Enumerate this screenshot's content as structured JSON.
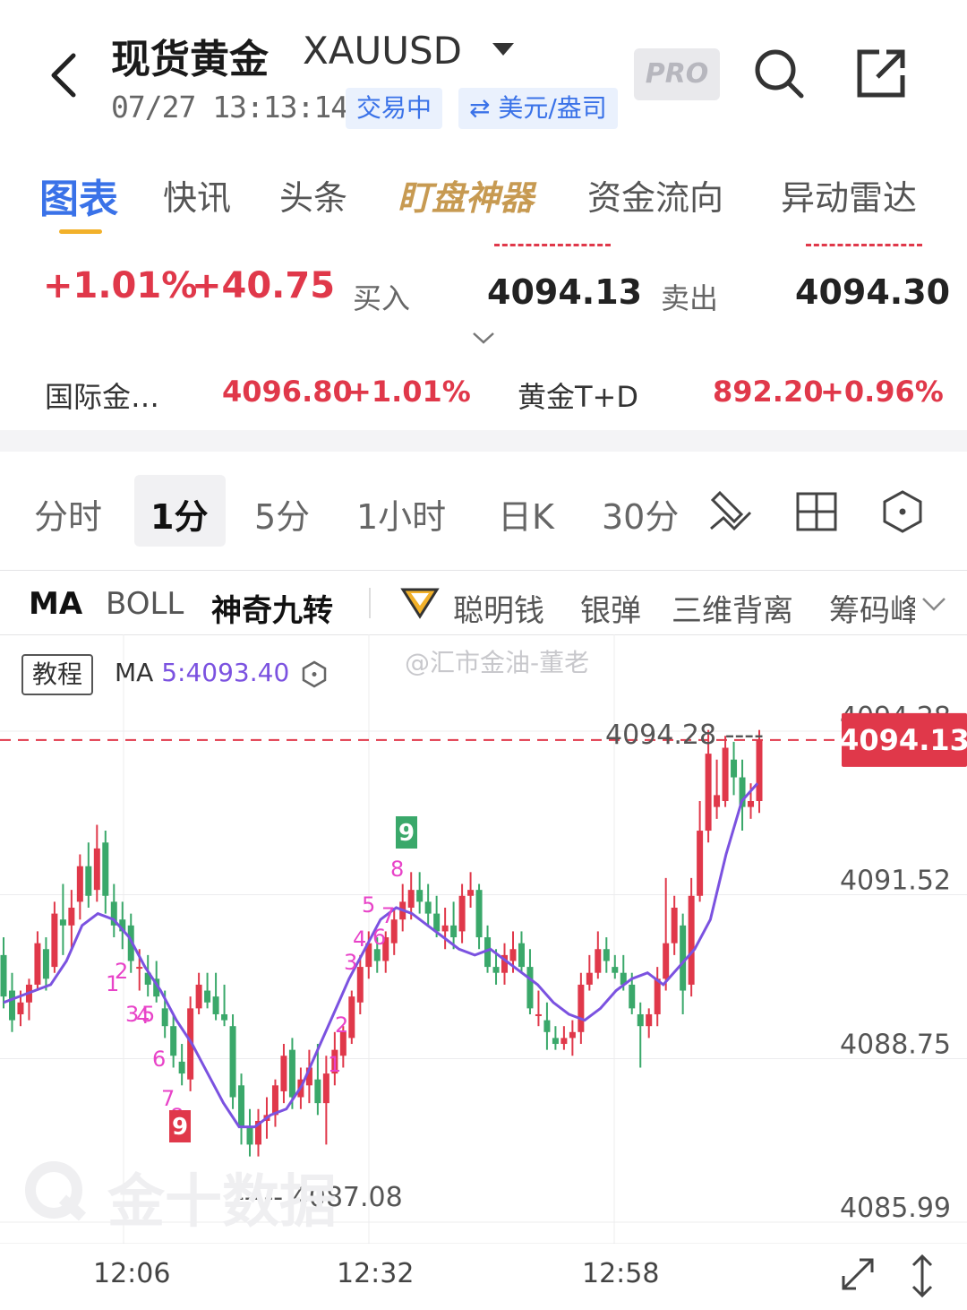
{
  "header": {
    "title": "现货黄金",
    "symbol": "XAUUSD",
    "pro_label": "PRO",
    "datetime": "07/27 13:13:14",
    "status_badge": "交易中",
    "currency_badge": "⇄ 美元/盎司"
  },
  "main_tabs": [
    "图表",
    "快讯",
    "头条",
    "盯盘神器",
    "资金流向",
    "异动雷达"
  ],
  "quote": {
    "change_pct": "+1.01%",
    "change_abs": "+40.75",
    "buy_label": "买入",
    "buy_value": "4094.13",
    "sell_label": "卖出",
    "sell_value": "4094.30"
  },
  "related": [
    {
      "name": "国际金…",
      "price": "4096.80",
      "pct": "+1.01%"
    },
    {
      "name": "黄金T+D",
      "price": "892.20",
      "pct": "+0.96%"
    }
  ],
  "period_tabs": [
    "分时",
    "1分",
    "5分",
    "1小时",
    "日K",
    "30分"
  ],
  "indicator_tabs": [
    "MA",
    "BOLL",
    "神奇九转",
    "聪明钱",
    "银弹",
    "三维背离",
    "筹码峰"
  ],
  "chart_header": {
    "tutorial_label": "教程",
    "ma_label": "MA",
    "ma_value": "5:4093.40",
    "watermark": "@汇市金油-董老",
    "logo_text": "金十数据"
  },
  "colors": {
    "up": "#e0384a",
    "down": "#3aa86a",
    "ma": "#7b52e0",
    "accent": "#3a72e8",
    "nine": "#e843c8"
  },
  "chart_data": {
    "type": "candlestick",
    "x_ticks": [
      "12:06",
      "12:32",
      "12:58"
    ],
    "y_ticks": [
      4094.28,
      4091.52,
      4088.75,
      4085.99
    ],
    "ylim": [
      4085.99,
      4094.28
    ],
    "last_price": "4094.13",
    "high_label": "4094.28",
    "low_label": "4087.08",
    "grid": true,
    "candles": [
      [
        4090.5,
        4090.8,
        4089.6,
        4089.8
      ],
      [
        4089.9,
        4090.2,
        4089.2,
        4089.4
      ],
      [
        4089.5,
        4089.9,
        4089.3,
        4089.7
      ],
      [
        4089.7,
        4090.1,
        4089.4,
        4090.0
      ],
      [
        4090.0,
        4090.9,
        4089.9,
        4090.7
      ],
      [
        4090.6,
        4090.8,
        4089.9,
        4090.1
      ],
      [
        4090.3,
        4091.4,
        4090.2,
        4091.2
      ],
      [
        4091.1,
        4091.7,
        4090.5,
        4091.0
      ],
      [
        4091.0,
        4091.6,
        4090.6,
        4091.3
      ],
      [
        4091.4,
        4092.2,
        4091.1,
        4092.0
      ],
      [
        4092.0,
        4092.4,
        4091.3,
        4091.5
      ],
      [
        4091.6,
        4092.7,
        4091.4,
        4092.3
      ],
      [
        4092.4,
        4092.6,
        4091.2,
        4091.5
      ],
      [
        4091.4,
        4091.7,
        4090.8,
        4091.0
      ],
      [
        4091.1,
        4091.4,
        4090.6,
        4090.9
      ],
      [
        4091.0,
        4091.2,
        4090.2,
        4090.4
      ],
      [
        4090.3,
        4090.6,
        4089.9,
        4090.3
      ],
      [
        4090.2,
        4090.5,
        4089.8,
        4090.0
      ],
      [
        4090.1,
        4090.4,
        4089.7,
        4089.8
      ],
      [
        4089.6,
        4089.9,
        4089.1,
        4089.3
      ],
      [
        4089.3,
        4089.5,
        4088.6,
        4088.8
      ],
      [
        4088.7,
        4089.0,
        4088.3,
        4088.5
      ],
      [
        4088.4,
        4089.8,
        4088.2,
        4089.6
      ],
      [
        4089.6,
        4090.2,
        4089.5,
        4090.0
      ],
      [
        4089.9,
        4090.2,
        4089.6,
        4089.7
      ],
      [
        4089.8,
        4090.2,
        4089.4,
        4089.5
      ],
      [
        4089.5,
        4090.0,
        4089.3,
        4089.4
      ],
      [
        4089.3,
        4089.5,
        4087.9,
        4088.1
      ],
      [
        4088.3,
        4088.5,
        4087.3,
        4087.6
      ],
      [
        4087.6,
        4087.9,
        4087.1,
        4087.3
      ],
      [
        4087.3,
        4087.9,
        4087.1,
        4087.7
      ],
      [
        4087.7,
        4088.1,
        4087.4,
        4087.8
      ],
      [
        4087.8,
        4088.4,
        4087.6,
        4088.3
      ],
      [
        4088.2,
        4089.0,
        4088.0,
        4088.8
      ],
      [
        4088.9,
        4089.1,
        4087.9,
        4088.1
      ],
      [
        4088.1,
        4088.6,
        4087.9,
        4088.4
      ],
      [
        4088.3,
        4088.9,
        4088.0,
        4088.6
      ],
      [
        4088.4,
        4089.0,
        4087.8,
        4088.0
      ],
      [
        4088.0,
        4088.8,
        4087.3,
        4088.5
      ],
      [
        4088.5,
        4089.2,
        4088.3,
        4088.9
      ],
      [
        4088.8,
        4089.3,
        4088.6,
        4089.2
      ],
      [
        4089.1,
        4089.9,
        4089.0,
        4089.8
      ],
      [
        4089.7,
        4090.5,
        4089.5,
        4090.3
      ],
      [
        4090.3,
        4090.9,
        4090.1,
        4090.7
      ],
      [
        4090.6,
        4090.8,
        4090.2,
        4090.4
      ],
      [
        4090.4,
        4090.9,
        4090.2,
        4090.8
      ],
      [
        4090.7,
        4091.3,
        4090.5,
        4091.1
      ],
      [
        4091.1,
        4091.7,
        4090.9,
        4091.4
      ],
      [
        4091.3,
        4091.9,
        4091.1,
        4091.6
      ],
      [
        4091.6,
        4091.9,
        4091.2,
        4091.4
      ],
      [
        4091.4,
        4091.7,
        4091.0,
        4091.2
      ],
      [
        4091.2,
        4091.5,
        4090.8,
        4090.9
      ],
      [
        4090.9,
        4091.3,
        4090.6,
        4091.0
      ],
      [
        4091.0,
        4091.4,
        4090.6,
        4090.8
      ],
      [
        4090.9,
        4091.7,
        4090.7,
        4091.5
      ],
      [
        4091.5,
        4091.9,
        4091.3,
        4091.6
      ],
      [
        4091.6,
        4091.7,
        4090.6,
        4090.8
      ],
      [
        4090.8,
        4091.0,
        4090.2,
        4090.3
      ],
      [
        4090.3,
        4090.6,
        4090.0,
        4090.2
      ],
      [
        4090.2,
        4090.7,
        4090.0,
        4090.5
      ],
      [
        4090.4,
        4090.9,
        4090.2,
        4090.6
      ],
      [
        4090.7,
        4090.9,
        4090.2,
        4090.3
      ],
      [
        4090.3,
        4090.6,
        4089.5,
        4089.6
      ],
      [
        4089.5,
        4089.9,
        4089.3,
        4089.5
      ],
      [
        4089.4,
        4089.7,
        4088.9,
        4089.2
      ],
      [
        4089.1,
        4089.3,
        4088.9,
        4089.0
      ],
      [
        4089.0,
        4089.3,
        4088.9,
        4089.1
      ],
      [
        4089.1,
        4089.4,
        4088.8,
        4089.2
      ],
      [
        4089.2,
        4090.2,
        4089.0,
        4090.0
      ],
      [
        4090.0,
        4090.5,
        4089.9,
        4090.2
      ],
      [
        4090.2,
        4090.9,
        4090.1,
        4090.6
      ],
      [
        4090.6,
        4090.8,
        4090.2,
        4090.4
      ],
      [
        4090.3,
        4090.5,
        4090.1,
        4090.2
      ],
      [
        4090.2,
        4090.5,
        4089.9,
        4090.0
      ],
      [
        4090.0,
        4090.2,
        4089.5,
        4089.6
      ],
      [
        4089.5,
        4089.7,
        4088.6,
        4089.3
      ],
      [
        4089.3,
        4089.6,
        4089.1,
        4089.5
      ],
      [
        4089.5,
        4090.3,
        4089.3,
        4090.1
      ],
      [
        4090.1,
        4091.8,
        4089.9,
        4090.7
      ],
      [
        4090.7,
        4091.5,
        4090.5,
        4091.3
      ],
      [
        4091.0,
        4091.2,
        4089.5,
        4089.9
      ],
      [
        4090.0,
        4091.8,
        4089.8,
        4091.5
      ],
      [
        4091.5,
        4093.1,
        4091.4,
        4092.6
      ],
      [
        4092.6,
        4094.3,
        4092.4,
        4093.9
      ],
      [
        4093.0,
        4093.8,
        4092.8,
        4093.2
      ],
      [
        4093.1,
        4094.2,
        4093.0,
        4094.0
      ],
      [
        4093.8,
        4094.1,
        4093.2,
        4093.5
      ],
      [
        4093.5,
        4093.8,
        4092.6,
        4093.0
      ],
      [
        4093.0,
        4093.4,
        4092.8,
        4093.1
      ],
      [
        4093.1,
        4094.3,
        4092.9,
        4094.13
      ]
    ],
    "ma5": [
      4089.7,
      4089.8,
      4089.9,
      4090.0,
      4090.4,
      4091.0,
      4091.2,
      4091.1,
      4090.8,
      4090.3,
      4089.9,
      4089.4,
      4089.0,
      4088.5,
      4088.0,
      4087.6,
      4087.6,
      4087.8,
      4087.9,
      4088.3,
      4088.9,
      4089.5,
      4090.1,
      4090.6,
      4091.1,
      4091.3,
      4091.2,
      4091.0,
      4090.8,
      4090.6,
      4090.5,
      4090.6,
      4090.4,
      4090.2,
      4090.0,
      4089.7,
      4089.5,
      4089.4,
      4089.6,
      4089.9,
      4090.1,
      4090.2,
      4090.0,
      4090.3,
      4090.6,
      4091.1,
      4092.2,
      4093.1,
      4093.4
    ],
    "nine_markers_up": [
      "1",
      "2",
      "3",
      "4",
      "5",
      "6",
      "7",
      "8",
      "9"
    ],
    "nine_markers_down": [
      "1",
      "2",
      "3",
      "4",
      "5",
      "6",
      "7",
      "8",
      "9"
    ]
  }
}
